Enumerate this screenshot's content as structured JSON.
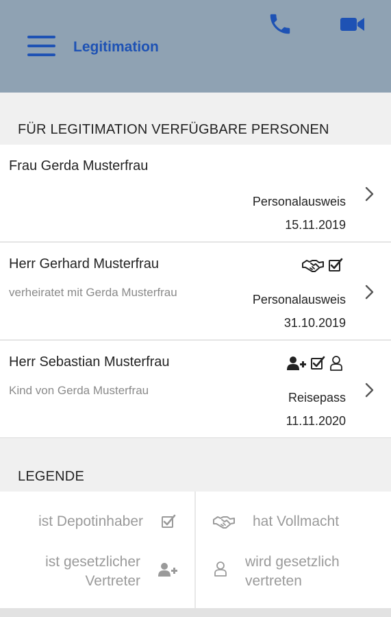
{
  "header": {
    "title": "Legitimation",
    "icons": {
      "menu": "hamburger-menu-icon",
      "phone": "phone-icon",
      "video": "video-camera-icon"
    },
    "background_color": "#8fa2b3",
    "accent_color": "#1e52b4"
  },
  "persons_section": {
    "title": "FÜR LEGITIMATION VERFÜGBARE PERSONEN"
  },
  "persons": [
    {
      "name": "Frau Gerda Musterfrau",
      "relation": "",
      "document": "Personalausweis",
      "date": "15.11.2019",
      "icons": []
    },
    {
      "name": "Herr Gerhard Musterfrau",
      "relation": "verheiratet mit Gerda Musterfrau",
      "document": "Personalausweis",
      "date": "31.10.2019",
      "icons": [
        "handshake-icon",
        "checkbox-icon"
      ]
    },
    {
      "name": "Herr Sebastian Musterfrau",
      "relation": "Kind von Gerda Musterfrau",
      "document": "Reisepass",
      "date": "11.11.2020",
      "icons": [
        "user-plus-icon",
        "checkbox-icon",
        "user-outline-icon"
      ]
    }
  ],
  "legend": {
    "title": "LEGENDE",
    "items": [
      {
        "label": "ist Depotinhaber",
        "icon": "checkbox-icon"
      },
      {
        "label_line1": "ist gesetzlicher",
        "label_line2": "Vertreter",
        "icon": "user-plus-icon"
      },
      {
        "label": "hat Vollmacht",
        "icon": "handshake-icon"
      },
      {
        "label_line1": "wird gesetzlich",
        "label_line2": "vertreten",
        "icon": "user-outline-icon"
      }
    ]
  }
}
